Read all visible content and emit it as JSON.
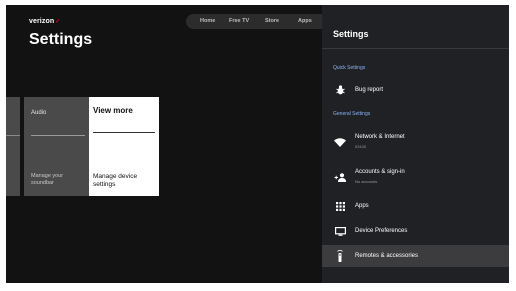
{
  "brand": {
    "name": "verizon",
    "mark": "✓"
  },
  "page": {
    "title": "Settings"
  },
  "topnav": {
    "items": [
      "Home",
      "Free TV",
      "Store",
      "Apps"
    ]
  },
  "cards": [
    {
      "title": "Audio",
      "description": "Manage your soundbar"
    },
    {
      "title": "View more",
      "description": "Manage device settings"
    }
  ],
  "panel": {
    "title": "Settings",
    "sections": [
      {
        "label": "Quick Settings",
        "items": [
          {
            "label": "Bug report",
            "icon": "bug-icon"
          }
        ]
      },
      {
        "label": "General Settings",
        "items": [
          {
            "label": "Network & Internet",
            "sublabel": "03100",
            "icon": "wifi-icon"
          },
          {
            "label": "Accounts & sign-in",
            "sublabel": "No accounts",
            "icon": "add-person-icon"
          },
          {
            "label": "Apps",
            "icon": "apps-grid-icon"
          },
          {
            "label": "Device Preferences",
            "icon": "tv-icon"
          },
          {
            "label": "Remotes & accessories",
            "icon": "remote-icon",
            "focused": true
          }
        ]
      }
    ]
  },
  "colors": {
    "background": "#121212",
    "panel": "#202124",
    "section_label": "#8ab4f8",
    "brand_check": "#e0001b"
  }
}
